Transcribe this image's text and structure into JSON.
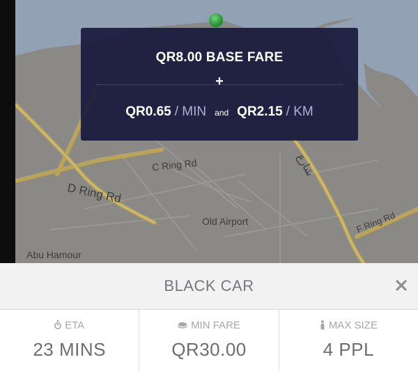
{
  "map": {
    "labels": {
      "c_ring": "C Ring Rd",
      "d_ring": "D Ring Rd",
      "old_airport": "Old Airport",
      "f_ring": "F Ring Rd",
      "abu_hamour": "Abu Hamour",
      "arabic": "شارع"
    }
  },
  "fare": {
    "base": "QR8.00 BASE FARE",
    "plus": "+",
    "per_min_amount": "QR0.65",
    "per_min_unit": "/ MIN",
    "and": "and",
    "per_km_amount": "QR2.15",
    "per_km_unit": "/ KM"
  },
  "vehicle": {
    "name": "BLACK CAR",
    "close_icon": "close-icon"
  },
  "stats": {
    "eta_label": "ETA",
    "eta_value": "23 MINS",
    "min_fare_label": "MIN FARE",
    "min_fare_value": "QR30.00",
    "max_size_label": "MAX SIZE",
    "max_size_value": "4 PPL"
  },
  "colors": {
    "card_bg": "#18193d",
    "unit_text": "#aab2d6",
    "pin": "#2aa83a",
    "road": "#b9a45a",
    "map_bg": "#8a8986"
  }
}
